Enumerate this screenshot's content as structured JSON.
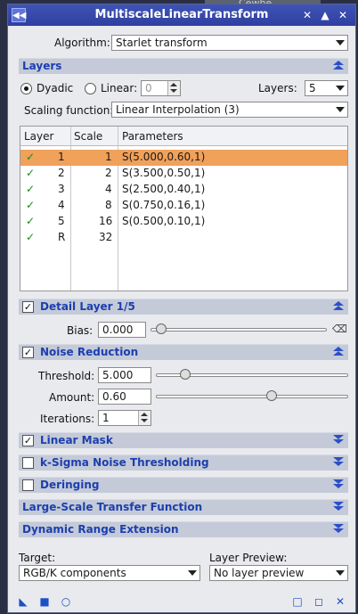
{
  "window": {
    "title": "MultiscaleLinearTransform",
    "bg_text": "Cewhe"
  },
  "algorithm": {
    "label": "Algorithm:",
    "value": "Starlet transform"
  },
  "layers_section": {
    "title": "Layers",
    "dyadic_label": "Dyadic",
    "linear_label": "Linear:",
    "linear_value": "0",
    "layers_label": "Layers:",
    "layers_value": "5",
    "scaling_label": "Scaling function:",
    "scaling_value": "Linear Interpolation (3)"
  },
  "table": {
    "headers": [
      "Layer",
      "Scale",
      "Parameters"
    ],
    "rows": [
      {
        "layer": "1",
        "scale": "1",
        "params": "S(5.000,0.60,1)",
        "checked": true,
        "selected": true
      },
      {
        "layer": "2",
        "scale": "2",
        "params": "S(3.500,0.50,1)",
        "checked": true,
        "selected": false
      },
      {
        "layer": "3",
        "scale": "4",
        "params": "S(2.500,0.40,1)",
        "checked": true,
        "selected": false
      },
      {
        "layer": "4",
        "scale": "8",
        "params": "S(0.750,0.16,1)",
        "checked": true,
        "selected": false
      },
      {
        "layer": "5",
        "scale": "16",
        "params": "S(0.500,0.10,1)",
        "checked": true,
        "selected": false
      },
      {
        "layer": "R",
        "scale": "32",
        "params": "",
        "checked": true,
        "selected": false
      }
    ]
  },
  "detail_layer": {
    "title": "Detail Layer 1/5",
    "bias_label": "Bias:",
    "bias_value": "0.000"
  },
  "noise_reduction": {
    "title": "Noise Reduction",
    "threshold_label": "Threshold:",
    "threshold_value": "5.000",
    "amount_label": "Amount:",
    "amount_value": "0.60",
    "iterations_label": "Iterations:",
    "iterations_value": "1"
  },
  "linear_mask": {
    "title": "Linear Mask"
  },
  "ksigma": {
    "title": "k-Sigma Noise Thresholding"
  },
  "deringing": {
    "title": "Deringing"
  },
  "large_scale": {
    "title": "Large-Scale Transfer Function"
  },
  "dynamic_range": {
    "title": "Dynamic Range Extension"
  },
  "target": {
    "label": "Target:",
    "value": "RGB/K components"
  },
  "layer_preview": {
    "label": "Layer Preview:",
    "value": "No layer preview"
  },
  "colors": {
    "title_bar": "#3346a8",
    "section_text": "#1c3fae",
    "selected_row": "#f0a15a",
    "check": "#1b8a1b"
  }
}
